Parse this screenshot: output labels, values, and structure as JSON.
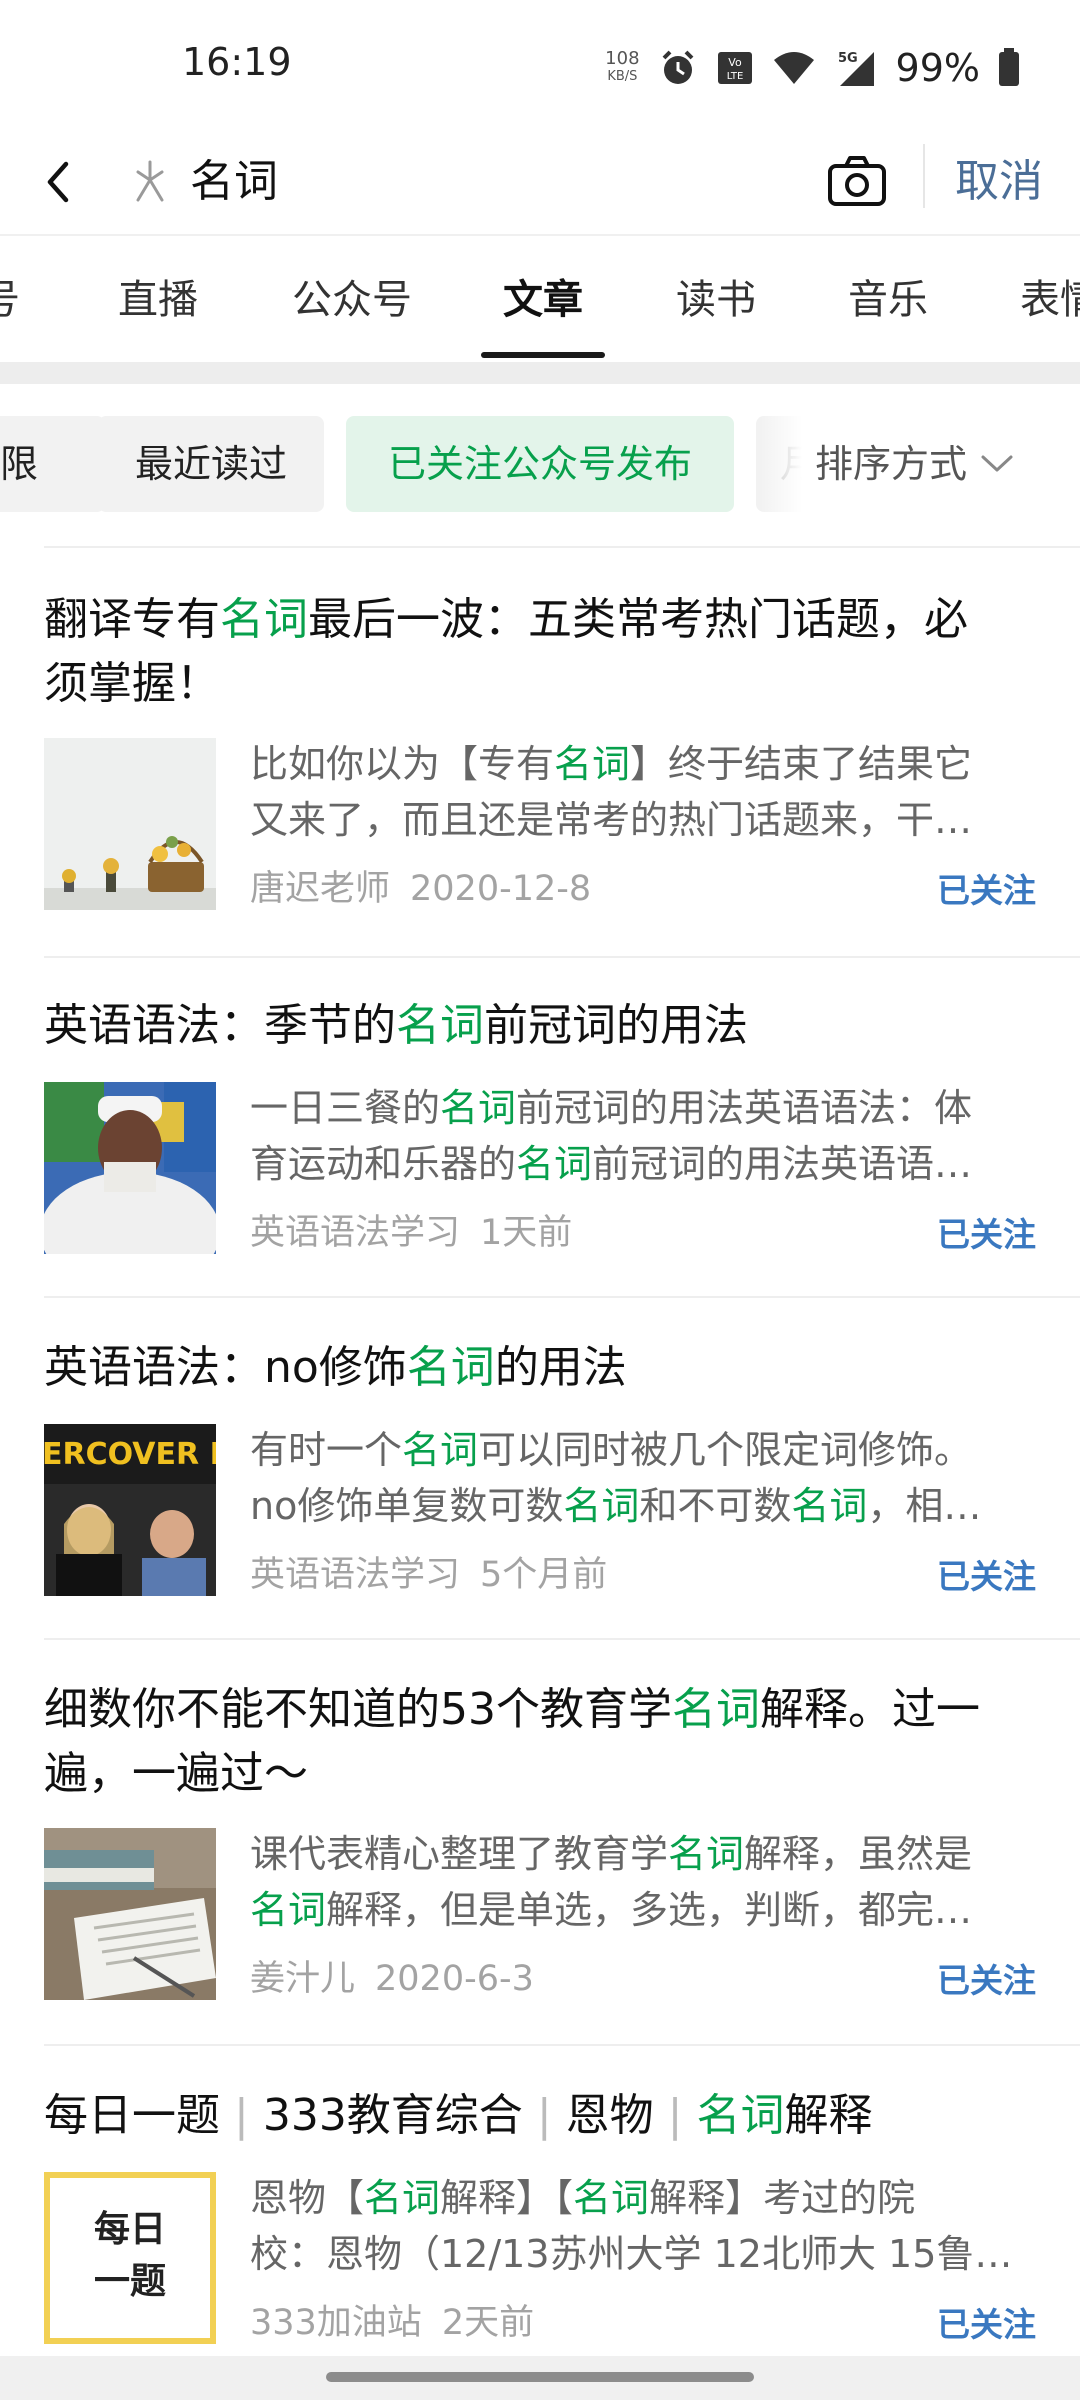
{
  "status_bar": {
    "time": "16:19",
    "net_speed_value": "108",
    "net_speed_unit": "KB/S",
    "battery": "99%",
    "icons": [
      "alarm-icon",
      "volte-icon",
      "wifi-icon",
      "5g-signal-icon",
      "battery-icon"
    ]
  },
  "nav": {
    "search_query": "名词",
    "cancel_label": "取消",
    "icons": [
      "back-arrow-icon",
      "search-logo-icon",
      "camera-icon"
    ]
  },
  "tabs": [
    "号",
    "直播",
    "公众号",
    "文章",
    "读书",
    "音乐",
    "表情"
  ],
  "active_tab": "文章",
  "filters": {
    "partial_label": "限",
    "recent_label": "最近读过",
    "followed_label": "已关注公众号发布",
    "month_partial": "月",
    "sort_label": "排序方式"
  },
  "colors": {
    "highlight": "#07a04c",
    "follow": "#3a78c0",
    "cancel": "#4b6e97",
    "chip_active_bg": "#e3f4ea"
  },
  "results": [
    {
      "title_parts": [
        "翻译专有",
        "名词",
        "最后一波：五类常考热门话题，必",
        "须掌握！"
      ],
      "snippet_line1_parts": [
        "比如你以为【专有",
        "名词",
        "】终于结束了结果它"
      ],
      "snippet_line2": "又来了，而且还是常考的热门话题来，干…",
      "author": "唐迟老师",
      "date": "2020-12-8",
      "follow_label": "已关注"
    },
    {
      "title_parts": [
        "英语语法：季节的",
        "名词",
        "前冠词的用法"
      ],
      "snippet_line1_parts": [
        "一日三餐的",
        "名词",
        "前冠词的用法英语语法：体"
      ],
      "snippet_line2_parts": [
        "育运动和乐器的",
        "名词",
        "前冠词的用法英语语…"
      ],
      "author": "英语语法学习",
      "date": "1天前",
      "follow_label": "已关注"
    },
    {
      "title_parts": [
        "英语语法：no修饰",
        "名词",
        "的用法"
      ],
      "snippet_line1_parts": [
        "有时一个",
        "名词",
        "可以同时被几个限定词修饰。"
      ],
      "snippet_line2_parts": [
        "no修饰单复数可数",
        "名词",
        "和不可数",
        "名词",
        "，相…"
      ],
      "thumb_text": "ERCOVER BU",
      "author": "英语语法学习",
      "date": "5个月前",
      "follow_label": "已关注"
    },
    {
      "title_parts": [
        "细数你不能不知道的53个教育学",
        "名词",
        "解释。过一",
        "遍，一遍过～"
      ],
      "snippet_line1_parts": [
        "课代表精心整理了教育学",
        "名词",
        "解释，虽然是"
      ],
      "snippet_line2_parts": [
        "名词",
        "解释，但是单选，多选，判断，都完…"
      ],
      "author": "姜汁儿",
      "date": "2020-6-3",
      "follow_label": "已关注"
    },
    {
      "title_parts": [
        "每日一题",
        "333教育综合",
        "恩物",
        "名词",
        "解释"
      ],
      "snippet_line1_parts": [
        "恩物【",
        "名词",
        "解释】【",
        "名词",
        "解释】考过的院"
      ],
      "snippet_line2": "校：恩物（12/13苏州大学 12北师大 15鲁…",
      "thumb_line1": "每日",
      "thumb_line2": "一题",
      "author": "333加油站",
      "date": "2天前",
      "follow_label": "已关注"
    }
  ]
}
